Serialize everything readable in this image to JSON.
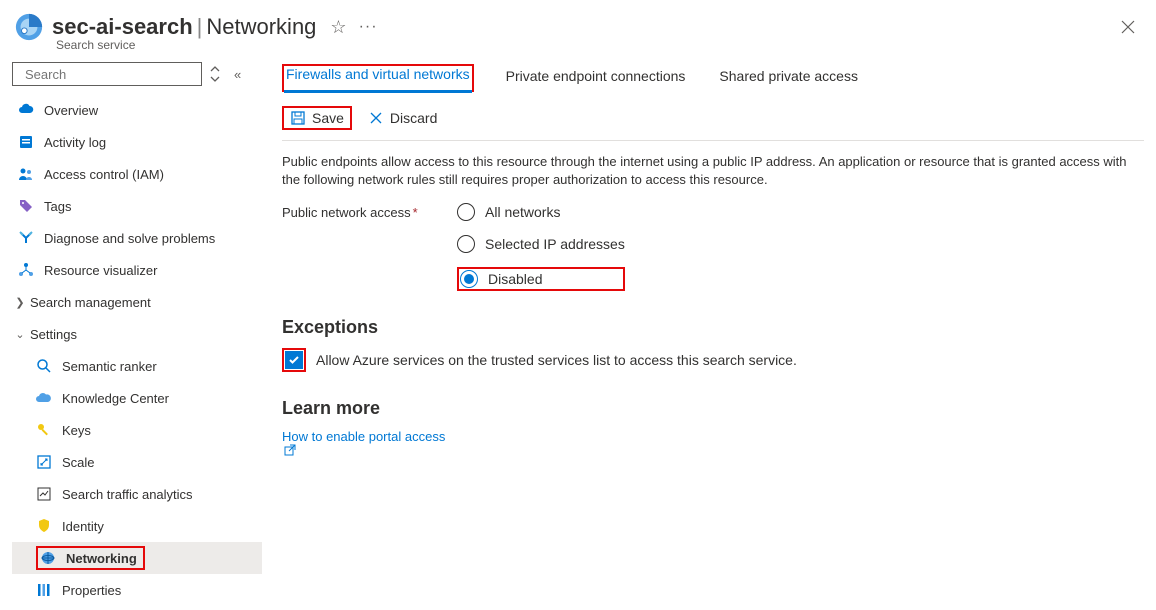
{
  "header": {
    "resource": "sec-ai-search",
    "page": "Networking",
    "subtitle": "Search service"
  },
  "sidebar": {
    "searchPlaceholder": "Search",
    "items": {
      "overview": "Overview",
      "activity": "Activity log",
      "iam": "Access control (IAM)",
      "tags": "Tags",
      "diagnose": "Diagnose and solve problems",
      "visualizer": "Resource visualizer"
    },
    "group1": "Search management",
    "group2": "Settings",
    "settings": {
      "semantic": "Semantic ranker",
      "knowledge": "Knowledge Center",
      "keys": "Keys",
      "scale": "Scale",
      "traffic": "Search traffic analytics",
      "identity": "Identity",
      "networking": "Networking",
      "properties": "Properties"
    }
  },
  "tabs": {
    "firewalls": "Firewalls and virtual networks",
    "private": "Private endpoint connections",
    "shared": "Shared private access"
  },
  "toolbar": {
    "save": "Save",
    "discard": "Discard"
  },
  "description": "Public endpoints allow access to this resource through the internet using a public IP address. An application or resource that is granted access with the following network rules still requires proper authorization to access this resource.",
  "form": {
    "label": "Public network access",
    "options": {
      "all": "All networks",
      "selected": "Selected IP addresses",
      "disabled": "Disabled"
    }
  },
  "exceptions": {
    "title": "Exceptions",
    "check": "Allow Azure services on the trusted services list to access this search service."
  },
  "learn": {
    "title": "Learn more",
    "link": "How to enable portal access"
  }
}
